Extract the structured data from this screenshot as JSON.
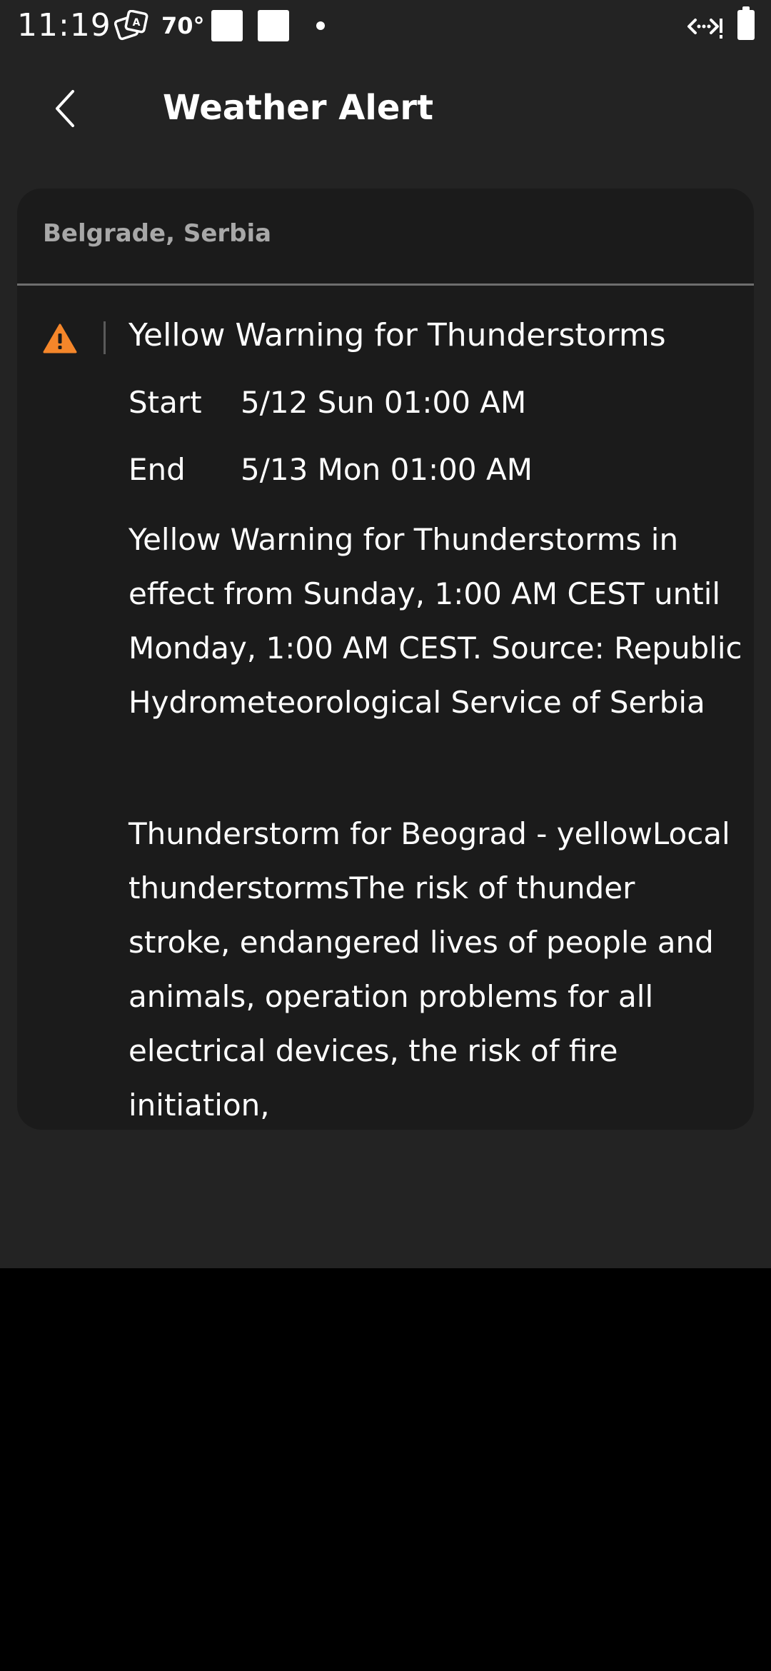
{
  "status_bar": {
    "time": "11:19",
    "temperature": "70°",
    "icons": [
      "translate-icon",
      "notification-square-icon",
      "notification-square-icon",
      "dot-icon",
      "network-icon",
      "battery-icon"
    ]
  },
  "app_bar": {
    "back_icon": "chevron-left-icon",
    "title": "Weather Alert"
  },
  "alert_card": {
    "location": "Belgrade, Serbia",
    "icon": "warning-triangle-icon",
    "icon_color": "#f5862a",
    "title": "Yellow Warning for Thunderstorms",
    "start_label": "Start",
    "start_value": "5/12 Sun 01:00 AM",
    "end_label": "End",
    "end_value": "5/13 Mon 01:00 AM",
    "summary": "Yellow Warning for Thunderstorms in effect from Sunday, 1:00 AM CEST until Monday, 1:00 AM CEST.  Source: Republic Hydrometeorological Service of Serbia",
    "detail": "Thunderstorm for Beograd - yellowLocal thunderstormsThe risk of thunder stroke, endangered lives of people and animals, operation problems for all electrical devices, the risk of fire initiation,"
  },
  "nav_bar": {
    "icons": [
      "nav-back-icon",
      "nav-home-icon",
      "nav-recents-icon"
    ]
  },
  "colors": {
    "background": "#232323",
    "card": "#1b1b1b",
    "nav_bar": "#1a1a1a",
    "warning": "#f5862a",
    "secondary_text": "#a8a8a8"
  }
}
